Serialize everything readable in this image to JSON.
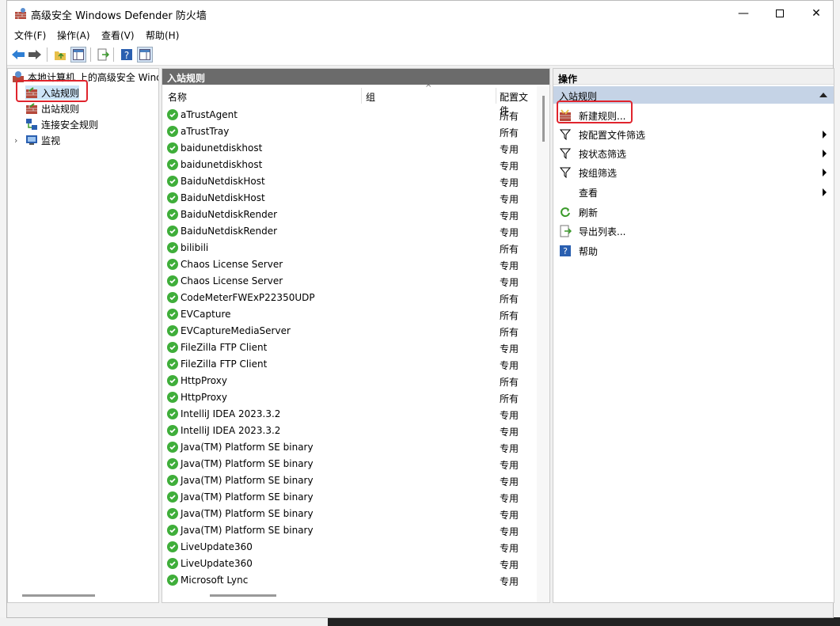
{
  "window": {
    "title": "高级安全 Windows Defender 防火墙"
  },
  "menu": [
    "文件(F)",
    "操作(A)",
    "查看(V)",
    "帮助(H)"
  ],
  "tree": {
    "root": "本地计算机 上的高级安全 Wind",
    "items": [
      "入站规则",
      "出站规则",
      "连接安全规则",
      "监视"
    ]
  },
  "middle": {
    "header": "入站规则",
    "columns": {
      "name": "名称",
      "group": "组",
      "profile": "配置文件"
    },
    "rules": [
      {
        "name": "aTrustAgent",
        "profile": "所有"
      },
      {
        "name": "aTrustTray",
        "profile": "所有"
      },
      {
        "name": "baidunetdiskhost",
        "profile": "专用"
      },
      {
        "name": "baidunetdiskhost",
        "profile": "专用"
      },
      {
        "name": "BaiduNetdiskHost",
        "profile": "专用"
      },
      {
        "name": "BaiduNetdiskHost",
        "profile": "专用"
      },
      {
        "name": "BaiduNetdiskRender",
        "profile": "专用"
      },
      {
        "name": "BaiduNetdiskRender",
        "profile": "专用"
      },
      {
        "name": "bilibili",
        "profile": "所有"
      },
      {
        "name": "Chaos License Server",
        "profile": "专用"
      },
      {
        "name": "Chaos License Server",
        "profile": "专用"
      },
      {
        "name": "CodeMeterFWExP22350UDP",
        "profile": "所有"
      },
      {
        "name": "EVCapture",
        "profile": "所有"
      },
      {
        "name": "EVCaptureMediaServer",
        "profile": "所有"
      },
      {
        "name": "FileZilla FTP Client",
        "profile": "专用"
      },
      {
        "name": "FileZilla FTP Client",
        "profile": "专用"
      },
      {
        "name": "HttpProxy",
        "profile": "所有"
      },
      {
        "name": "HttpProxy",
        "profile": "所有"
      },
      {
        "name": "IntelliJ IDEA 2023.3.2",
        "profile": "专用"
      },
      {
        "name": "IntelliJ IDEA 2023.3.2",
        "profile": "专用"
      },
      {
        "name": "Java(TM) Platform SE binary",
        "profile": "专用"
      },
      {
        "name": "Java(TM) Platform SE binary",
        "profile": "专用"
      },
      {
        "name": "Java(TM) Platform SE binary",
        "profile": "专用"
      },
      {
        "name": "Java(TM) Platform SE binary",
        "profile": "专用"
      },
      {
        "name": "Java(TM) Platform SE binary",
        "profile": "专用"
      },
      {
        "name": "Java(TM) Platform SE binary",
        "profile": "专用"
      },
      {
        "name": "LiveUpdate360",
        "profile": "专用"
      },
      {
        "name": "LiveUpdate360",
        "profile": "专用"
      },
      {
        "name": "Microsoft Lync",
        "profile": "专用"
      }
    ]
  },
  "actions": {
    "header": "操作",
    "section": "入站规则",
    "items": [
      "新建规则...",
      "按配置文件筛选",
      "按状态筛选",
      "按组筛选",
      "查看",
      "刷新",
      "导出列表...",
      "帮助"
    ]
  }
}
